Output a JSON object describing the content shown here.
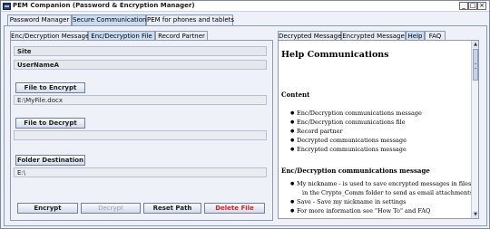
{
  "window": {
    "title": "PEM Companion (Password & Encryption Manager)"
  },
  "window_controls": {
    "minimize": "_",
    "maximize": "□",
    "close": "×"
  },
  "main_tabs": [
    {
      "label": "Password Manager",
      "active": false
    },
    {
      "label": "Secure Communications",
      "active": true
    },
    {
      "label": "PEM for phones and tablets",
      "active": false
    }
  ],
  "left_tabs": [
    {
      "label": "Enc/Decryption Message",
      "active": false
    },
    {
      "label": "Enc/Decryption File",
      "active": true
    },
    {
      "label": "Record Partner",
      "active": false
    }
  ],
  "right_tabs": [
    {
      "label": "Decrypted Message",
      "active": false
    },
    {
      "label": "Encrypted Message",
      "active": false
    },
    {
      "label": "Help",
      "active": true
    },
    {
      "label": "FAQ",
      "active": false
    }
  ],
  "left_panel": {
    "site": "Site",
    "username": "UserNameA",
    "file_to_encrypt_button": "File to Encrypt",
    "encrypt_path": "E:\\MyFile.docx",
    "file_to_decrypt_button": "File to Decrypt",
    "decrypt_path": "",
    "folder_destination_button": "Folder Destination",
    "destination_path": "E:\\",
    "actions": {
      "encrypt": "Encrypt",
      "decrypt": "Decrypt",
      "reset_path": "Reset Path",
      "delete_file": "Delete File"
    }
  },
  "help": {
    "title": "Help Communications",
    "content_heading": "Content",
    "content_items": [
      "Enc/Decryption communications message",
      "Enc/Decryption communications file",
      "Record partner",
      "Decrypted communications message",
      "Encrypted communications message"
    ],
    "section_heading": "Enc/Decryption communications message",
    "section_items": [
      "My nickname - is used to save encrypted messages in files",
      "Save - Save my nickname in settings",
      "For more information see \"How To\" and FAQ"
    ],
    "section_item_0_continuation": "in the Crypto_Comm folder to send as email attachments"
  },
  "colors": {
    "accent_tab": "#c9dcf2",
    "delete_text": "#e0201c",
    "disabled_text": "#9aa0aa"
  },
  "icons": {
    "app": "app-icon",
    "scroll_up": "scroll-up-icon",
    "scroll_down": "scroll-down-icon"
  }
}
